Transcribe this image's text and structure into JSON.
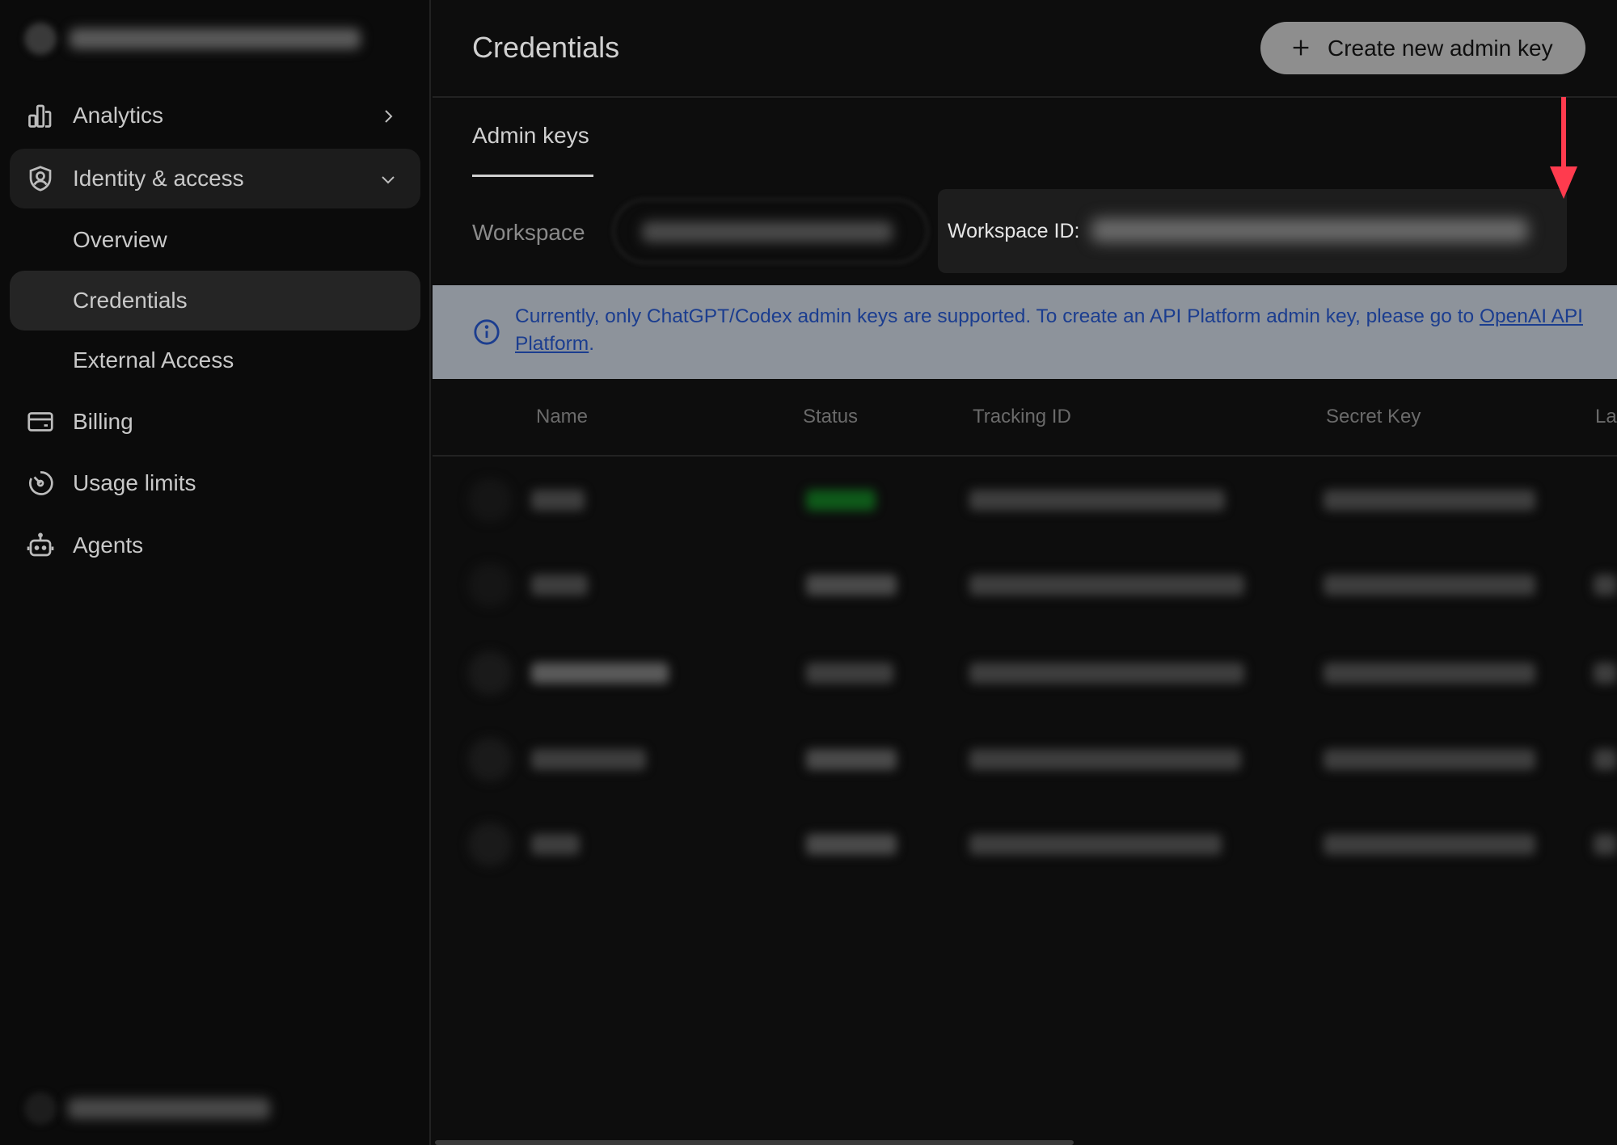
{
  "sidebar": {
    "items": [
      {
        "label": "Analytics",
        "icon": "bar-chart-icon",
        "chevron": "chevron-right-icon"
      },
      {
        "label": "Identity & access",
        "icon": "shield-user-icon",
        "chevron": "chevron-down-icon"
      },
      {
        "label": "Overview"
      },
      {
        "label": "Credentials"
      },
      {
        "label": "External Access"
      },
      {
        "label": "Billing",
        "icon": "credit-card-icon"
      },
      {
        "label": "Usage limits",
        "icon": "gauge-icon"
      },
      {
        "label": "Agents",
        "icon": "robot-icon"
      }
    ]
  },
  "header": {
    "title": "Credentials",
    "create_button": "Create new admin key"
  },
  "tabs": {
    "admin_keys": "Admin keys"
  },
  "workspace": {
    "label": "Workspace",
    "id_label": "Workspace ID:"
  },
  "banner": {
    "text": "Currently, only ChatGPT/Codex admin keys are supported. To create an API Platform admin key, please go to ",
    "link": "OpenAI API Platform",
    "tail": "."
  },
  "table": {
    "columns": [
      "Name",
      "Status",
      "Tracking ID",
      "Secret Key",
      "La"
    ]
  },
  "colors": {
    "annotation_arrow": "#ff3b4e",
    "banner_bg": "#8d939b",
    "banner_text": "#1b3d8f"
  }
}
